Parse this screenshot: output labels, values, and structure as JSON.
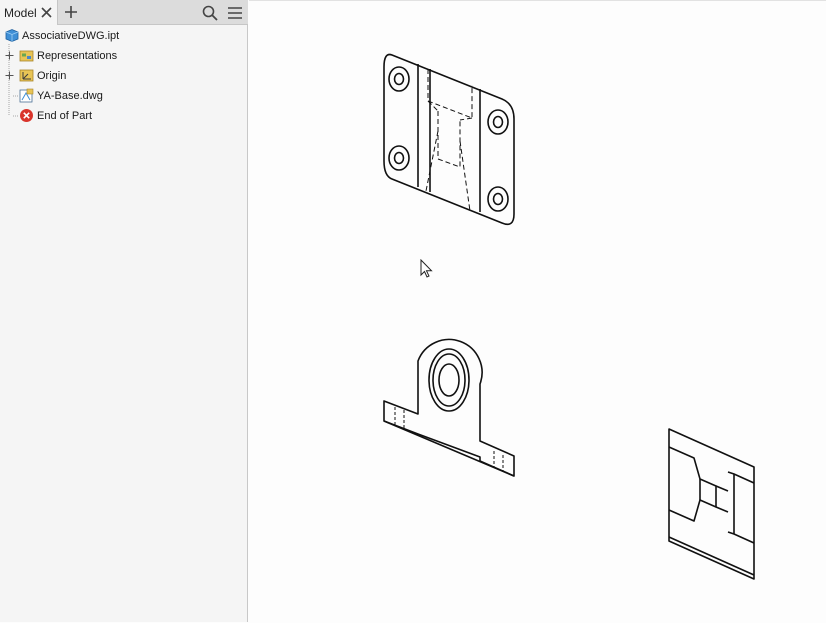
{
  "browser": {
    "tab_label": "Model",
    "tree": [
      {
        "label": "AssociativeDWG.ipt",
        "icon": "part-cube-icon"
      },
      {
        "label": "Representations",
        "icon": "representations-folder-icon"
      },
      {
        "label": "Origin",
        "icon": "origin-folder-icon"
      },
      {
        "label": "YA-Base.dwg",
        "icon": "dwg-underlay-icon"
      },
      {
        "label": "End of Part",
        "icon": "end-of-part-icon"
      }
    ]
  },
  "colors": {
    "accent_blue": "#3f8fd6",
    "folder_yellow": "#e8c455",
    "end_of_part_red": "#d9342b"
  }
}
